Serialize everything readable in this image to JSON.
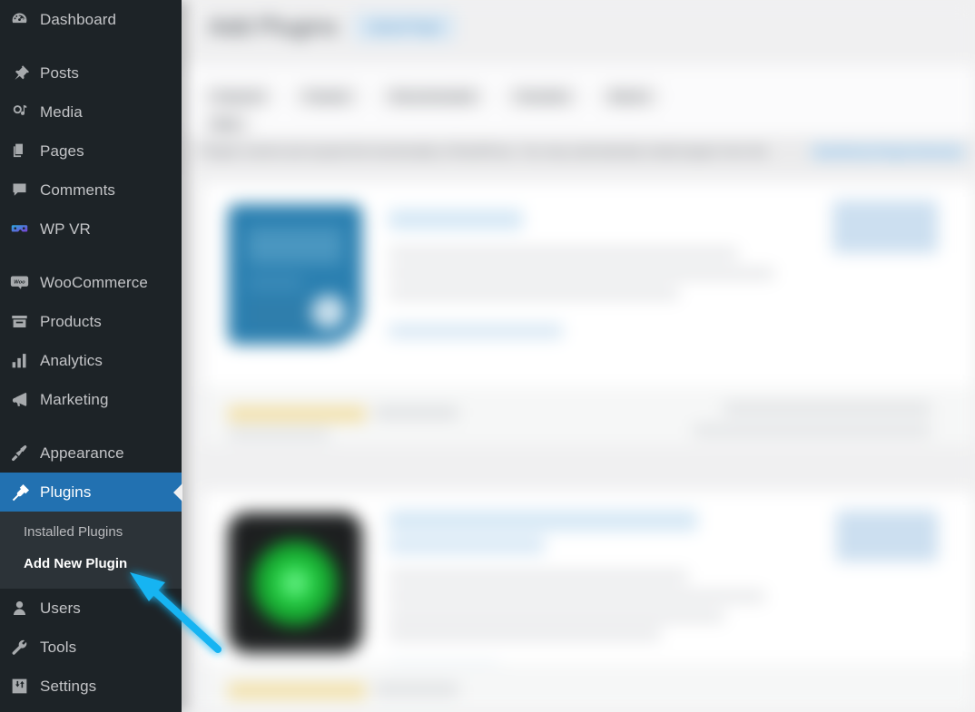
{
  "sidebar": {
    "items": [
      {
        "label": "Dashboard",
        "icon": "dashboard-gauge-icon",
        "active": false,
        "gap_after": true
      },
      {
        "label": "Posts",
        "icon": "pin-icon",
        "active": false,
        "gap_after": false
      },
      {
        "label": "Media",
        "icon": "media-icon",
        "active": false,
        "gap_after": false
      },
      {
        "label": "Pages",
        "icon": "pages-icon",
        "active": false,
        "gap_after": false
      },
      {
        "label": "Comments",
        "icon": "comment-bubble-icon",
        "active": false,
        "gap_after": false
      },
      {
        "label": "WP VR",
        "icon": "vr-goggles-icon",
        "active": false,
        "gap_after": true
      },
      {
        "label": "WooCommerce",
        "icon": "woo-icon",
        "active": false,
        "gap_after": false
      },
      {
        "label": "Products",
        "icon": "products-box-icon",
        "active": false,
        "gap_after": false
      },
      {
        "label": "Analytics",
        "icon": "analytics-bars-icon",
        "active": false,
        "gap_after": false
      },
      {
        "label": "Marketing",
        "icon": "megaphone-icon",
        "active": false,
        "gap_after": true
      },
      {
        "label": "Appearance",
        "icon": "paintbrush-icon",
        "active": false,
        "gap_after": false
      },
      {
        "label": "Plugins",
        "icon": "plug-icon",
        "active": true,
        "gap_after": false
      }
    ],
    "submenu": [
      {
        "label": "Installed Plugins",
        "current": false
      },
      {
        "label": "Add New Plugin",
        "current": true
      }
    ],
    "items_after": [
      {
        "label": "Users",
        "icon": "user-icon",
        "active": false,
        "gap_after": false
      },
      {
        "label": "Tools",
        "icon": "wrench-icon",
        "active": false,
        "gap_after": false
      },
      {
        "label": "Settings",
        "icon": "settings-sliders-icon",
        "active": false,
        "gap_after": false
      }
    ]
  },
  "main": {
    "page_title": "Add Plugins",
    "upload_button": "Upload Plugin",
    "tabs": [
      "Featured",
      "Popular",
      "Recommended",
      "Favorites",
      "Blocks"
    ],
    "tabs_row2": [
      "Beta"
    ],
    "notice_text": "Plugins extend and expand the functionality of WordPress. You may automatically install plugins from the",
    "notice_link": "WordPress Plugin Directory",
    "plugins": [
      {
        "name": "Plugin Title",
        "icon": "plugin-icon-blue",
        "install_button": "Install Now",
        "more_details": "More Details",
        "rating_text": "Rating",
        "rating_count": "reviews",
        "meta_line_1": "Last Updated",
        "meta_line_2": "Active Installations"
      },
      {
        "name": "Plugin Title Two",
        "icon": "plugin-icon-green",
        "install_button": "Install Now",
        "more_details": "More Details",
        "rating_text": "Rating",
        "rating_count": "reviews",
        "meta_line_1": "Last Updated",
        "meta_line_2": "Active Installations"
      }
    ]
  },
  "annotation": {
    "type": "arrow",
    "color": "#18b4f2",
    "points_to": "Add New Plugin"
  },
  "colors": {
    "sidebar_bg": "#1d2327",
    "submenu_bg": "#2c3338",
    "accent_blue": "#2271b1",
    "content_bg": "#f0f0f1",
    "arrow_cyan": "#18b4f2"
  }
}
